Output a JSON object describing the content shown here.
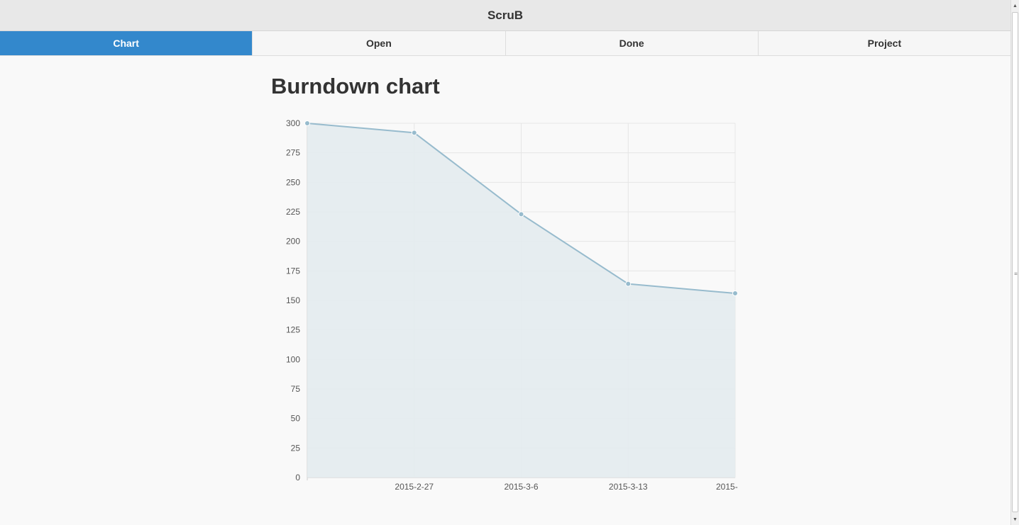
{
  "app": {
    "title": "ScruB"
  },
  "tabs": [
    {
      "label": "Chart",
      "active": true
    },
    {
      "label": "Open",
      "active": false
    },
    {
      "label": "Done",
      "active": false
    },
    {
      "label": "Project",
      "active": false
    }
  ],
  "page": {
    "title": "Burndown chart"
  },
  "colors": {
    "accent": "#3388cc",
    "line": "#97bbcd",
    "fill": "#e3ebef"
  },
  "icons": {
    "scroll_up": "triangle-up",
    "scroll_down": "triangle-down",
    "scroll_grip": "grip-lines"
  },
  "chart_data": {
    "type": "area",
    "title": "",
    "xlabel": "",
    "ylabel": "",
    "x": [
      "",
      "2015-2-27",
      "2015-3-6",
      "2015-3-13",
      "2015-"
    ],
    "series": [
      {
        "values": [
          300,
          292,
          223,
          164,
          156
        ]
      }
    ],
    "ylim": [
      0,
      300
    ],
    "yticks": [
      0,
      25,
      50,
      75,
      100,
      125,
      150,
      175,
      200,
      225,
      250,
      275,
      300
    ],
    "grid": true,
    "legend": "none"
  }
}
